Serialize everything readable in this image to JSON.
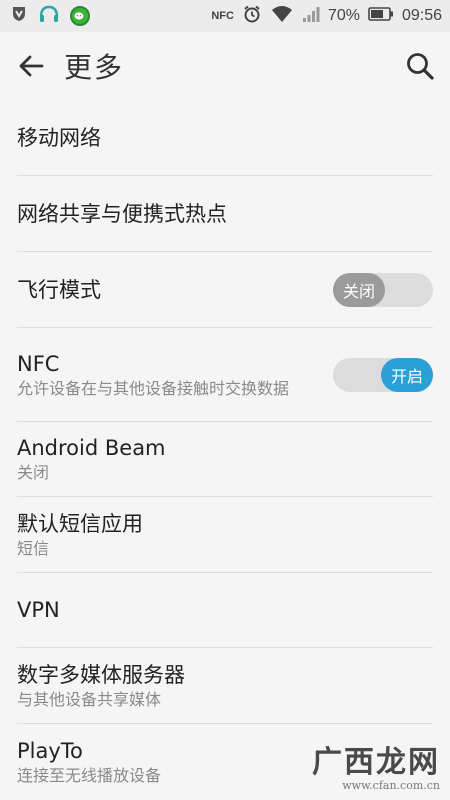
{
  "status_bar": {
    "nfc_label": "NFC",
    "battery": "70%",
    "time": "09:56"
  },
  "header": {
    "title": "更多"
  },
  "items": [
    {
      "title": "移动网络"
    },
    {
      "title": "网络共享与便携式热点"
    },
    {
      "title": "飞行模式",
      "toggle_label": "关闭",
      "toggle_on": false
    },
    {
      "title": "NFC",
      "subtitle": "允许设备在与其他设备接触时交换数据",
      "toggle_label": "开启",
      "toggle_on": true
    },
    {
      "title": "Android Beam",
      "subtitle": "关闭"
    },
    {
      "title": "默认短信应用",
      "subtitle": "短信"
    },
    {
      "title": "VPN"
    },
    {
      "title": "数字多媒体服务器",
      "subtitle": "与其他设备共享媒体"
    },
    {
      "title": "PlayTo",
      "subtitle": "连接至无线播放设备"
    }
  ],
  "watermark": {
    "logo": "广西龙网",
    "site": "www.cfan.com.cn"
  },
  "colors": {
    "accent": "#2b9fd8",
    "toggle_off_knob": "#9b9b9b",
    "toggle_track": "#dcdcdc",
    "background": "#f5f5f5"
  }
}
